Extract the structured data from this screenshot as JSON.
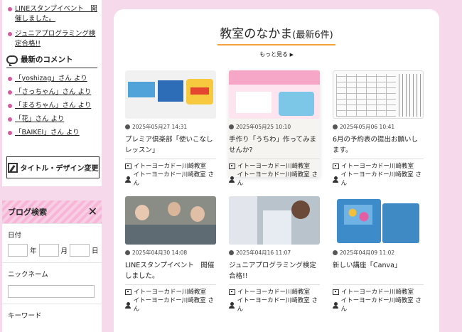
{
  "sidebar": {
    "news": [
      "LINEスタンプイベント　開催しました。",
      "ジュニアプログラミング検定合格!!"
    ],
    "comments_title": "最新のコメント",
    "comments": [
      "「yoshizag」さん より",
      "「さっちゃん」さん より",
      "「まるちゃん」さん より",
      "「花」さん より",
      "「BAIKEI」さん より"
    ],
    "design_button": "タイトル・デザイン変更",
    "search": {
      "title": "ブログ検索",
      "date_label": "日付",
      "year": "年",
      "month": "月",
      "day": "日",
      "nickname_label": "ニックネーム",
      "keyword_label": "キーワード"
    }
  },
  "main": {
    "title": "教室のなかま",
    "title_sub": "(最新6件)",
    "more_link": "もっと見る",
    "cards": [
      {
        "date": "2025年05月27 14:31",
        "title": "プレミア倶楽部「使いこなしレッスン」",
        "school": "イトーヨーカドー川崎教室",
        "author": "イトーヨーカドー川崎教室 さん"
      },
      {
        "date": "2025年05月25 10:10",
        "title": "手作り「うちわ」作ってみませんか?",
        "school": "イトーヨーカドー川崎教室",
        "author": "イトーヨーカドー川崎教室 さん"
      },
      {
        "date": "2025年05月06 10:41",
        "title": "6月の予約表の提出お願いします。",
        "school": "イトーヨーカドー川崎教室",
        "author": "イトーヨーカドー川崎教室 さん"
      },
      {
        "date": "2025年04月30 14:08",
        "title": "LINEスタンプイベント　開催しました。",
        "school": "イトーヨーカドー川崎教室",
        "author": "イトーヨーカドー川崎教室 さん"
      },
      {
        "date": "2025年04月16 11:07",
        "title": "ジュニアプログラミング検定合格!!",
        "school": "イトーヨーカドー川崎教室",
        "author": "イトーヨーカドー川崎教室 さん"
      },
      {
        "date": "2025年04月09 11:02",
        "title": "新しい講座「Canva」",
        "school": "イトーヨーカドー川崎教室",
        "author": "イトーヨーカドー川崎教室 さん"
      }
    ]
  },
  "colors": {
    "background": "#f7d9ec",
    "accent_pink": "#d65aa0",
    "title_underline": "#f4a23a"
  },
  "icons": [
    "chat-bubble-icon",
    "pencil-icon",
    "close-icon",
    "clock-icon",
    "building-icon",
    "person-icon",
    "chevron-right-icon"
  ]
}
